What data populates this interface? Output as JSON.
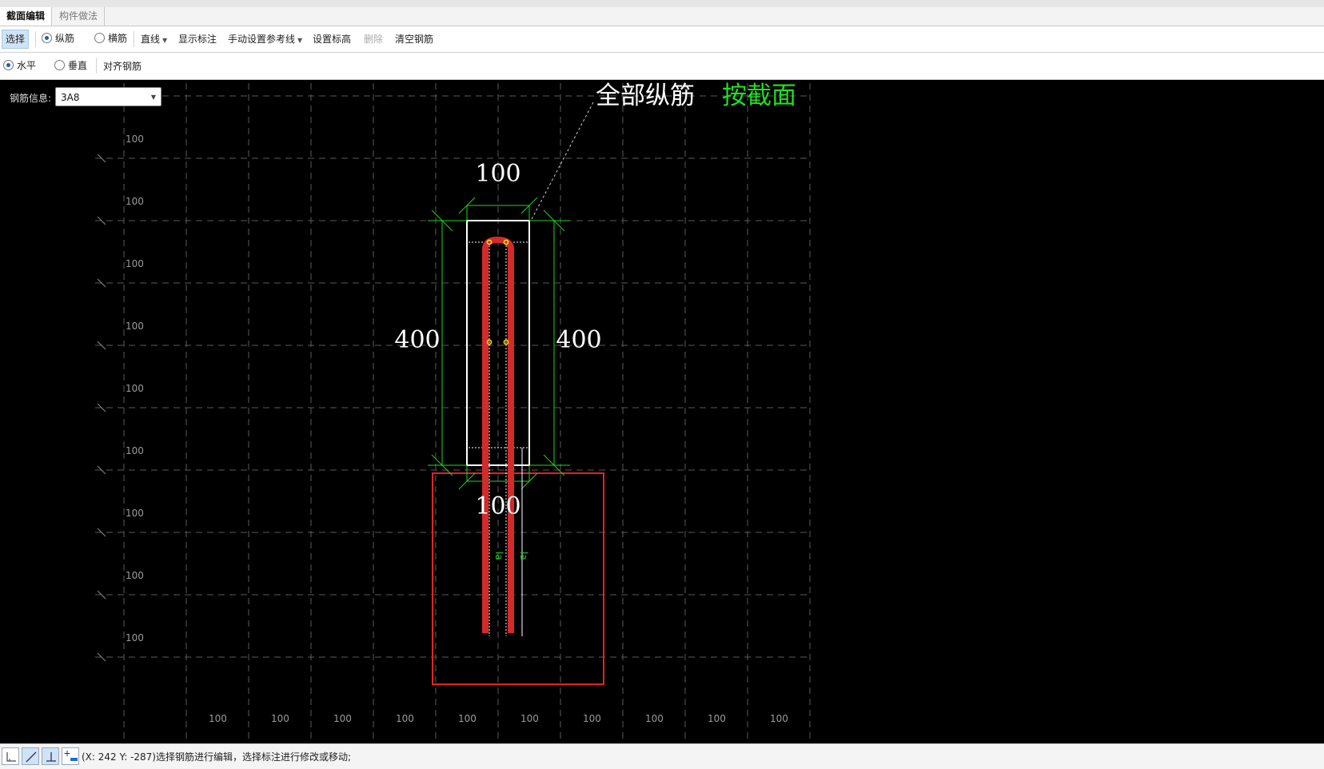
{
  "tabs": [
    {
      "label": "截面编辑"
    },
    {
      "label": "构件做法"
    }
  ],
  "toolbar": {
    "select": "选择",
    "radio_longitudinal": "纵筋",
    "radio_transverse": "横筋",
    "line": "直线",
    "show_dimension": "显示标注",
    "manual_reference": "手动设置参考线",
    "set_elevation": "设置标高",
    "delete": "删除",
    "clear_rebar": "清空钢筋"
  },
  "toolbar2": {
    "radio_horizontal": "水平",
    "radio_vertical": "垂直",
    "align_rebar": "对齐钢筋"
  },
  "canvas": {
    "rebar_info_label": "钢筋信息:",
    "rebar_info_value": "3A8",
    "header_label": "全部纵筋",
    "header_mode": "按截面",
    "dim_top": "100",
    "dim_bottom": "100",
    "dim_left": "400",
    "dim_right": "400",
    "anchor_label_1": "la",
    "anchor_label_2": "la",
    "grid_left_labels": [
      "100",
      "100",
      "100",
      "100",
      "100",
      "100",
      "100",
      "100",
      "100"
    ],
    "grid_bottom_labels": [
      "100",
      "100",
      "100",
      "100",
      "100",
      "100",
      "100",
      "100",
      "100",
      "100"
    ]
  },
  "colors": {
    "canvas_bg": "#000000",
    "grid": "#5a5a5a",
    "dimension": "#1fd41f",
    "rebar": "#d42a2a",
    "section_outline": "#ffffff",
    "mode_text": "#22dd22"
  },
  "statusbar": {
    "icons": [
      "ortho-mode-icon",
      "line-mode-icon",
      "perpendicular-icon",
      "add-point-icon"
    ],
    "text": "(X: 242 Y: -287)选择钢筋进行编辑，选择标注进行修改或移动;"
  }
}
